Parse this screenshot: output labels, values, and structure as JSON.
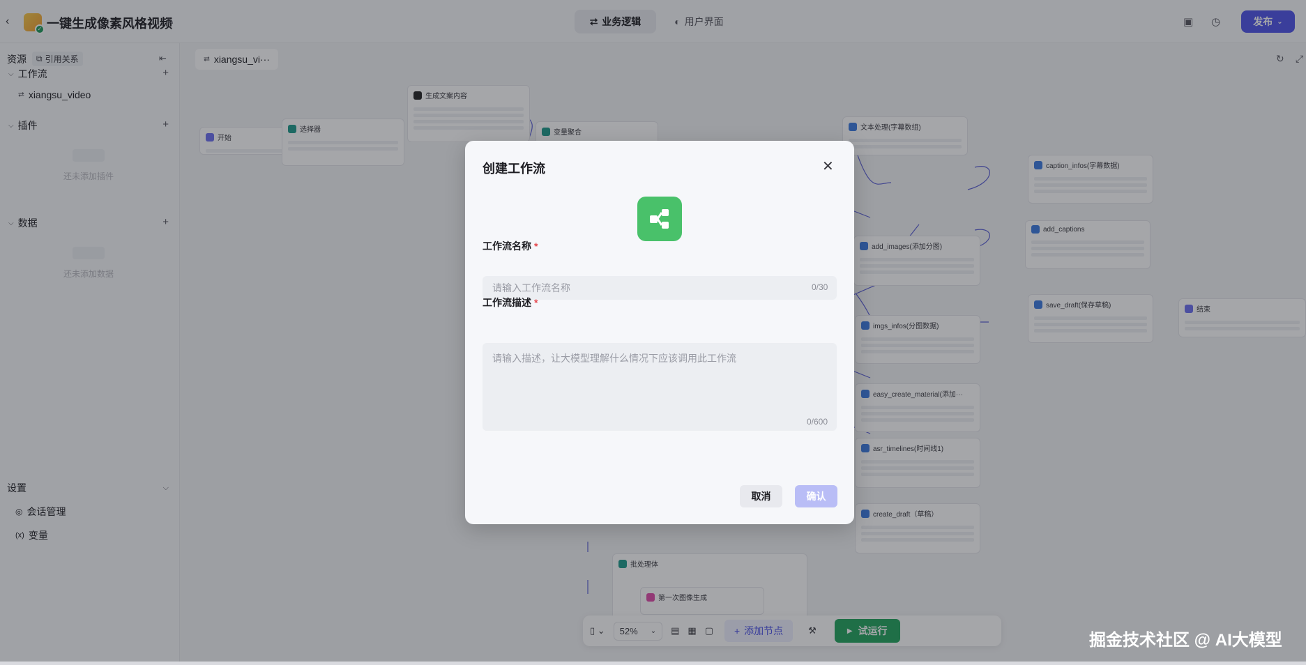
{
  "topbar": {
    "title": "一键生成像素风格视频",
    "tabs": [
      {
        "label": "业务逻辑",
        "active": true
      },
      {
        "label": "用户界面",
        "active": false
      }
    ],
    "publish_label": "发布"
  },
  "sidebar": {
    "header": "资源",
    "ref_label": "引用关系",
    "sections": {
      "workflow": {
        "title": "工作流",
        "items": [
          "xiangsu_video"
        ]
      },
      "plugin": {
        "title": "插件",
        "empty": "还未添加插件"
      },
      "data": {
        "title": "数据",
        "empty": "还未添加数据"
      }
    },
    "settings": {
      "title": "设置",
      "items": [
        "会话管理",
        "变量"
      ]
    }
  },
  "canvas": {
    "tab_label": "xiangsu_vi···",
    "nodes": [
      "开始",
      "选择器",
      "生成文案内容",
      "变量聚合",
      "文本处理(字幕数组)",
      "caption_infos(字幕数据)",
      "add_images(添加分图)",
      "add_captions",
      "save_draft(保存草稿)",
      "结束",
      "imgs_infos(分图数据)",
      "easy_create_material(添加···",
      "asr_timelines(时间线1)",
      "create_draft（草稿）",
      "批处理体",
      "第一次图像生成"
    ],
    "toolbar": {
      "zoom": "52%",
      "add_node_label": "添加节点",
      "run_label": "试运行"
    }
  },
  "watermark": "掘金技术社区 @ AI大模型",
  "modal": {
    "title": "创建工作流",
    "name_label": "工作流名称",
    "name_placeholder": "请输入工作流名称",
    "name_value": "",
    "name_counter": "0/30",
    "desc_label": "工作流描述",
    "desc_placeholder": "请输入描述，让大模型理解什么情况下应该调用此工作流",
    "desc_value": "",
    "desc_counter": "0/600",
    "cancel_label": "取消",
    "confirm_label": "确认"
  },
  "colors": {
    "accent": "#4d53e8",
    "run_green": "#21a35c",
    "logo_green": "#49c16a",
    "required_red": "#e5484d"
  }
}
